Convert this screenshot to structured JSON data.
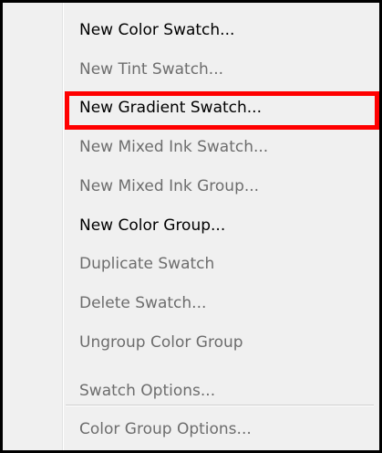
{
  "menu": {
    "items": [
      {
        "label": "New Color Swatch...",
        "enabled": true
      },
      {
        "label": "New Tint Swatch...",
        "enabled": false
      },
      {
        "label": "New Gradient Swatch...",
        "enabled": true
      },
      {
        "label": "New Mixed Ink Swatch...",
        "enabled": false
      },
      {
        "label": "New Mixed Ink Group...",
        "enabled": false
      },
      {
        "label": "New Color Group...",
        "enabled": true
      },
      {
        "label": "Duplicate Swatch",
        "enabled": false
      },
      {
        "label": "Delete Swatch...",
        "enabled": false
      },
      {
        "label": "Ungroup Color Group",
        "enabled": false
      },
      {
        "label": "Swatch Options...",
        "enabled": false
      },
      {
        "label": "Color Group Options...",
        "enabled": false
      }
    ],
    "highlighted_item": "New Gradient Swatch...",
    "highlight_color": "#ff0000"
  }
}
